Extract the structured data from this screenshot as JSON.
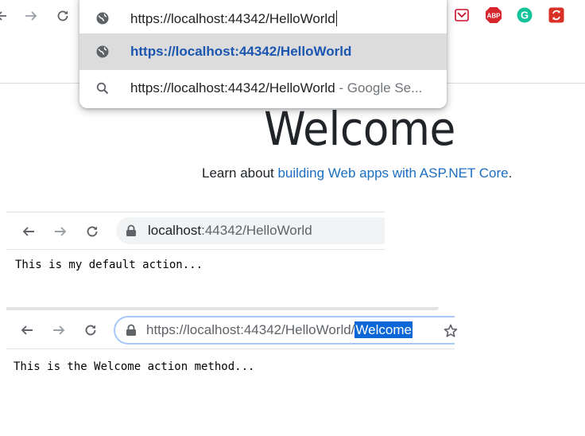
{
  "top_browser": {
    "omnibox": {
      "input_value": "https://localhost:44342/HelloWorld",
      "suggestions": [
        {
          "label": "https://localhost:44342/HelloWorld",
          "suffix": ""
        },
        {
          "label": "https://localhost:44342/HelloWorld",
          "suffix": " - Google Se..."
        }
      ]
    },
    "extensions": {
      "abp_label": "ABP",
      "grammarly_label": "G"
    }
  },
  "page": {
    "heading": "Welcome",
    "learn_prefix": "Learn about ",
    "learn_link": "building Web apps with ASP.NET Core",
    "learn_suffix": "."
  },
  "shot2": {
    "address_host": "localhost",
    "address_path": ":44342/HelloWorld",
    "body_text": "This is my default action..."
  },
  "shot3": {
    "address_prefix": "https://localhost",
    "address_path": ":44342/HelloWorld/",
    "address_selected": "Welcome",
    "body_text": "This is the Welcome action method..."
  },
  "colors": {
    "link": "#1b6ec2",
    "selection": "#0b66d8",
    "suggest_highlight": "#dcdcdc",
    "focus_ring": "#a8c7fa",
    "abp_red": "#d6262c",
    "grammarly_green": "#15c39a"
  }
}
